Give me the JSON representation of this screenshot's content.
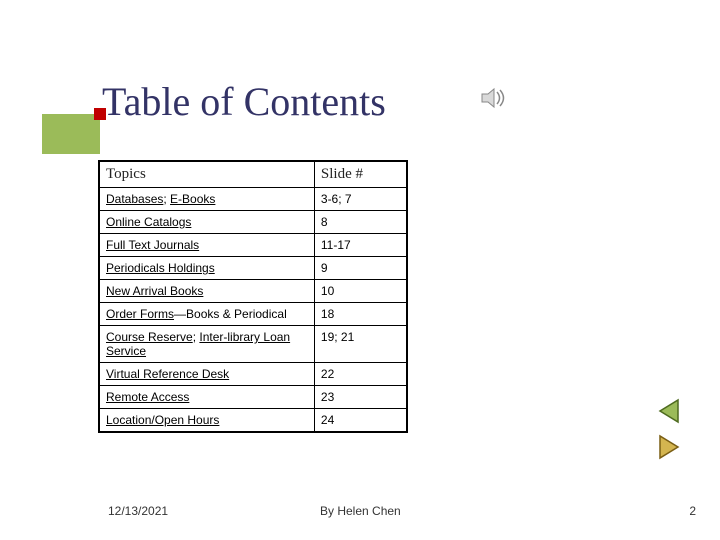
{
  "title": "Table of Contents",
  "table": {
    "headers": {
      "topics": "Topics",
      "slide": "Slide #"
    },
    "rows": [
      {
        "cells": [
          {
            "parts": [
              {
                "text": "Databases",
                "link": true
              },
              {
                "text": "; ",
                "link": false
              },
              {
                "text": "E-Books",
                "link": true
              }
            ]
          },
          {
            "parts": [
              {
                "text": "3-6;  7",
                "link": false
              }
            ]
          }
        ]
      },
      {
        "cells": [
          {
            "parts": [
              {
                "text": "Online Catalogs",
                "link": true
              }
            ]
          },
          {
            "parts": [
              {
                "text": "8",
                "link": false
              }
            ]
          }
        ]
      },
      {
        "cells": [
          {
            "parts": [
              {
                "text": "Full Text Journals",
                "link": true
              }
            ]
          },
          {
            "parts": [
              {
                "text": "11-17",
                "link": false
              }
            ]
          }
        ]
      },
      {
        "cells": [
          {
            "parts": [
              {
                "text": "Periodicals Holdings",
                "link": true
              }
            ]
          },
          {
            "parts": [
              {
                "text": "9",
                "link": false
              }
            ]
          }
        ]
      },
      {
        "cells": [
          {
            "parts": [
              {
                "text": "New Arrival Books",
                "link": true
              }
            ]
          },
          {
            "parts": [
              {
                "text": "10",
                "link": false
              }
            ]
          }
        ]
      },
      {
        "cells": [
          {
            "parts": [
              {
                "text": "Order Forms",
                "link": true
              },
              {
                "text": "—Books & Periodical",
                "link": false
              }
            ]
          },
          {
            "parts": [
              {
                "text": "18",
                "link": false
              }
            ]
          }
        ]
      },
      {
        "cells": [
          {
            "parts": [
              {
                "text": "Course Reserve",
                "link": true
              },
              {
                "text": "; ",
                "link": false
              },
              {
                "text": "Inter-library Loan Service",
                "link": true
              }
            ]
          },
          {
            "parts": [
              {
                "text": "19; 21",
                "link": false
              }
            ]
          }
        ]
      },
      {
        "cells": [
          {
            "parts": [
              {
                "text": "Virtual Reference Desk",
                "link": true
              }
            ]
          },
          {
            "parts": [
              {
                "text": "22",
                "link": false
              }
            ]
          }
        ]
      },
      {
        "cells": [
          {
            "parts": [
              {
                "text": "Remote  Access",
                "link": true
              }
            ]
          },
          {
            "parts": [
              {
                "text": "23",
                "link": false
              }
            ]
          }
        ]
      },
      {
        "cells": [
          {
            "parts": [
              {
                "text": "Location/Open Hours",
                "link": true
              }
            ]
          },
          {
            "parts": [
              {
                "text": "24",
                "link": false
              }
            ]
          }
        ]
      }
    ]
  },
  "footer": {
    "date": "12/13/2021",
    "author": "By Helen Chen",
    "page": "2"
  }
}
